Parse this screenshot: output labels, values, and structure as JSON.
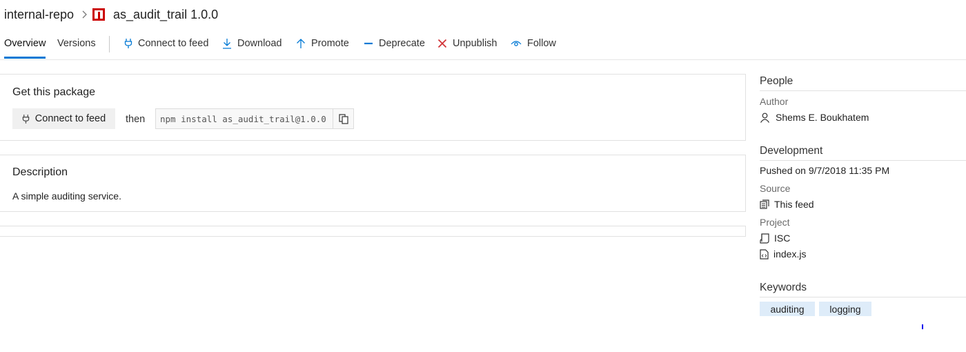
{
  "breadcrumb": {
    "feed": "internal-repo",
    "package": "as_audit_trail 1.0.0"
  },
  "tabs": [
    {
      "label": "Overview",
      "active": true
    },
    {
      "label": "Versions",
      "active": false
    }
  ],
  "toolbar": {
    "connect": "Connect to feed",
    "download": "Download",
    "promote": "Promote",
    "deprecate": "Deprecate",
    "unpublish": "Unpublish",
    "follow": "Follow"
  },
  "get_package": {
    "title": "Get this package",
    "connect_button": "Connect to feed",
    "then": "then",
    "command": "npm install as_audit_trail@1.0.0"
  },
  "description": {
    "title": "Description",
    "text": "A simple auditing service."
  },
  "people": {
    "title": "People",
    "author_label": "Author",
    "author": "Shems E. Boukhatem"
  },
  "development": {
    "title": "Development",
    "pushed": "Pushed on 9/7/2018 11:35 PM",
    "source_label": "Source",
    "source": "This feed",
    "project_label": "Project",
    "license": "ISC",
    "main": "index.js"
  },
  "keywords": {
    "title": "Keywords",
    "items": [
      "auditing",
      "logging"
    ]
  },
  "colors": {
    "accent": "#0078d4",
    "unpublish_red": "#d13438",
    "package_red": "#cb0000",
    "tag_bg": "#deecf9"
  }
}
